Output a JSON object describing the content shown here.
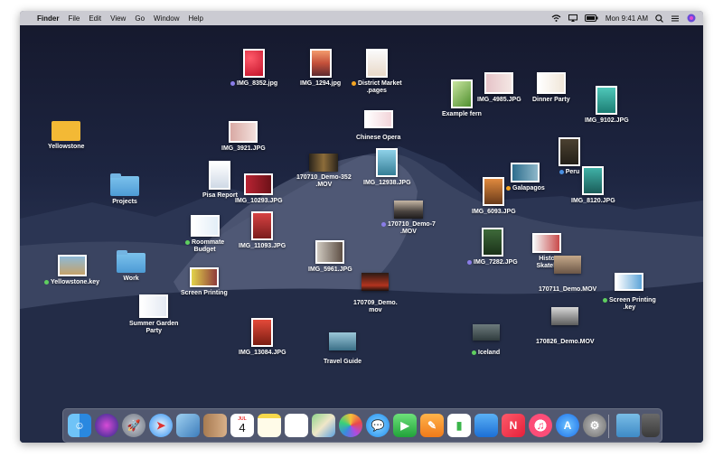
{
  "menubar": {
    "app_name": "Finder",
    "items": [
      "File",
      "Edit",
      "View",
      "Go",
      "Window",
      "Help"
    ],
    "clock": "Mon 9:41 AM"
  },
  "desktop": {
    "img_8352": "IMG_8352.jpg",
    "img_1294": "IMG_1294.jpg",
    "district_market_1": "District Market",
    "district_market_2": ".pages",
    "example_fern": "Example fern",
    "img_4985": "IMG_4985.JPG",
    "dinner_party": "Dinner Party",
    "img_9102": "IMG_9102.JPG",
    "yellowstone": "Yellowstone",
    "img_3921": "IMG_3921.JPG",
    "chinese_opera": "Chinese Opera",
    "peru": "Peru",
    "img_8120": "IMG_8120.JPG",
    "projects": "Projects",
    "pisa_report": "Pisa Report",
    "img_10293": "IMG_10293.JPG",
    "demo352_1": "170710_Demo-352",
    "demo352_2": ".MOV",
    "img_12938": "IMG_12938.JPG",
    "galapagos": "Galapagos",
    "img_6093": "IMG_6093.JPG",
    "roommate_1": "Roommate",
    "roommate_2": "Budget",
    "img_11093": "IMG_11093.JPG",
    "demo7_1": "170710_Demo-7",
    "demo7_2": ".MOV",
    "yellowstone_key": "Yellowstone.key",
    "work": "Work",
    "screen_printing": "Screen Printing",
    "img_5961": "IMG_5961.JPG",
    "img_7282": "IMG_7282.JPG",
    "historic_1": "Histo",
    "historic_2": "Skateb",
    "demo711": "170711_Demo.MOV",
    "screen_printing_key_1": "Screen Printing",
    "screen_printing_key_2": ".key",
    "summer_1": "Summer Garden",
    "summer_2": "Party",
    "demo709_1": "170709_Demo.",
    "demo709_2": "mov",
    "demo826": "170826_Demo.MOV",
    "img_13084": "IMG_13084.JPG",
    "travel_guide": "Travel Guide",
    "iceland": "Iceland"
  },
  "tag_colors": {
    "purple": "#8a7de8",
    "orange": "#f5a623",
    "blue": "#4a90e2",
    "green": "#5fcf5f"
  },
  "dock": {
    "calendar_month": "JUL",
    "calendar_day": "4",
    "items": [
      "finder-icon",
      "siri-icon",
      "launchpad-icon",
      "safari-icon",
      "photos-preview-icon",
      "contacts-icon",
      "calendar-icon",
      "notes-icon",
      "reminders-icon",
      "maps-icon",
      "photos-icon",
      "messages-icon",
      "facetime-icon",
      "pages-icon",
      "numbers-icon",
      "keynote-icon",
      "news-icon",
      "music-icon",
      "app-store-icon",
      "system-preferences-icon",
      "downloads-folder-icon",
      "trash-icon"
    ]
  }
}
